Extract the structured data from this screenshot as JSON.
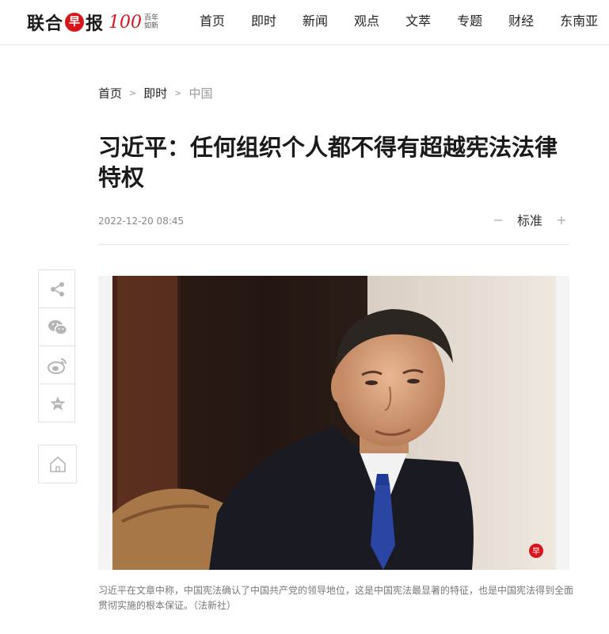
{
  "header": {
    "logo": {
      "name": "联合早报",
      "badge": "早",
      "anniversary": "100",
      "tagline": "百年如新"
    },
    "nav": [
      "首页",
      "即时",
      "新闻",
      "观点",
      "文萃",
      "专题",
      "财经",
      "东南亚"
    ]
  },
  "breadcrumb": {
    "items": [
      "首页",
      "即时",
      "中国"
    ],
    "separator": ">"
  },
  "article": {
    "title": "习近平：任何组织个人都不得有超越宪法法律特权",
    "date": "2022-12-20 08:45",
    "font_size": {
      "decrease": "−",
      "label": "标准",
      "increase": "+"
    },
    "photo": {
      "watermark": "早"
    },
    "caption": "习近平在文章中称，中国宪法确认了中国共产党的领导地位，这是中国宪法最显著的特征，也是中国宪法得到全面贯彻实施的根本保证。（法新社）"
  },
  "share": {
    "icons": [
      "share-icon",
      "wechat-icon",
      "weibo-icon",
      "favorite-icon"
    ],
    "home": "home-icon"
  },
  "colors": {
    "brand": "#d7141a",
    "text": "#222222",
    "muted": "#888888",
    "border": "#e6e6e6"
  }
}
